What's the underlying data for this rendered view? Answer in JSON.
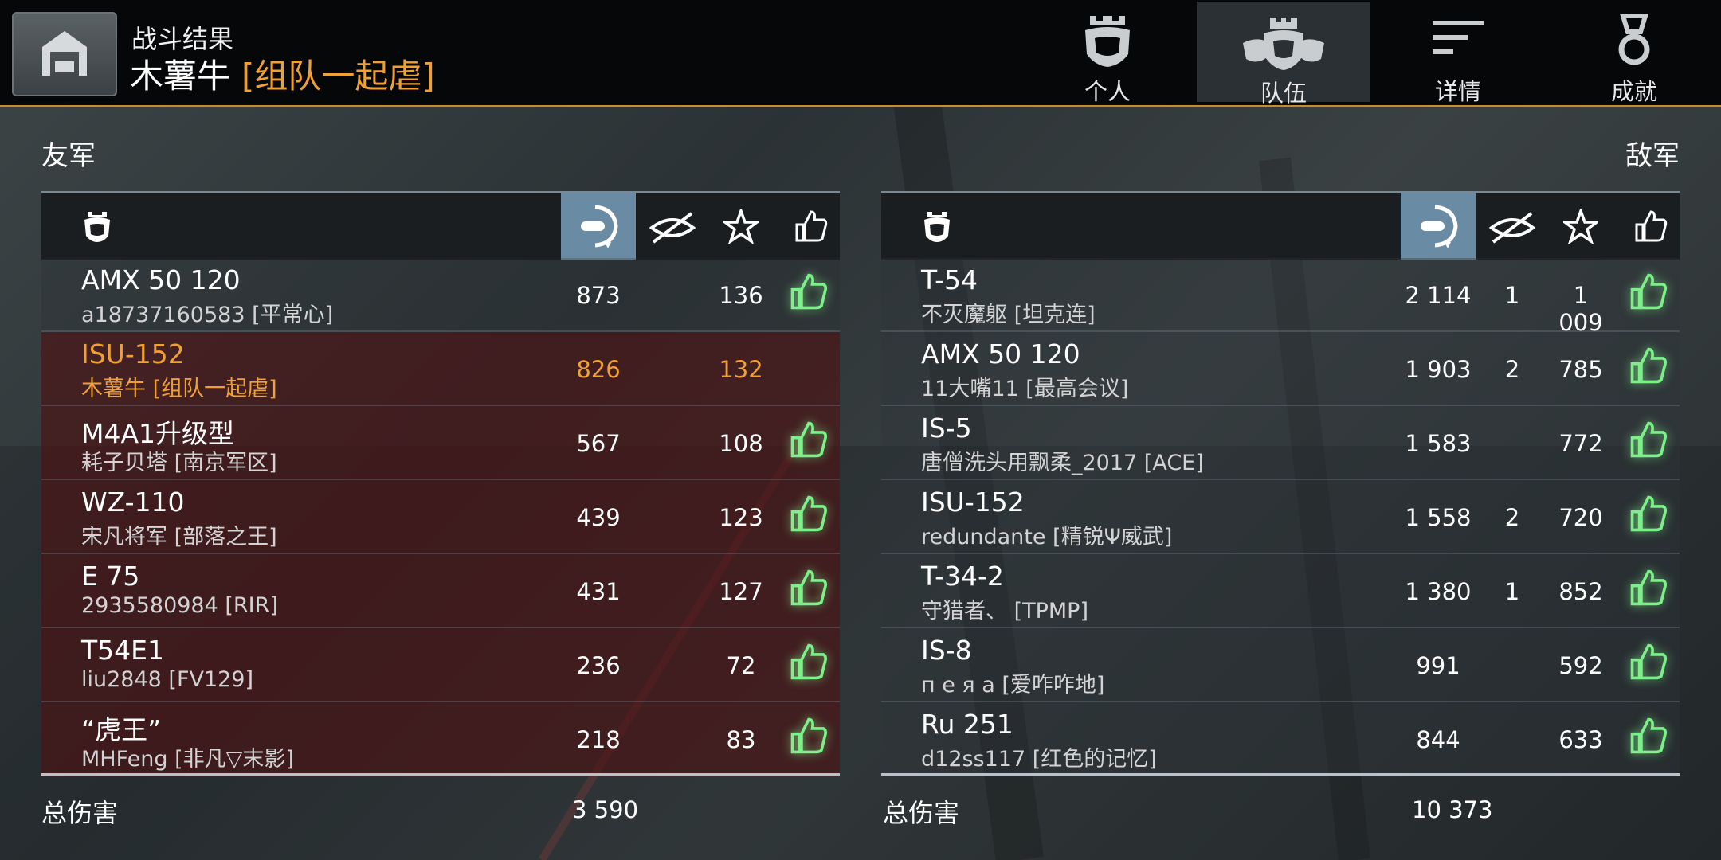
{
  "header": {
    "subtitle": "战斗结果",
    "player_name": "木薯牛",
    "player_clan": "[组队一起虐]"
  },
  "tabs": [
    {
      "label": "个人",
      "icon": "helmet-icon",
      "active": false
    },
    {
      "label": "队伍",
      "icon": "team-helmets-icon",
      "active": true
    },
    {
      "label": "详情",
      "icon": "list-lines-icon",
      "active": false
    },
    {
      "label": "成就",
      "icon": "medal-icon",
      "active": false
    }
  ],
  "allies": {
    "label": "友军",
    "rows": [
      {
        "vehicle": "AMX 50 120",
        "player": "a18737160583 [平常心]",
        "damage": "873",
        "spotted": "",
        "exp": "136",
        "liked": true
      },
      {
        "vehicle": "ISU-152",
        "player": "木薯牛 [组队一起虐]",
        "damage": "826",
        "spotted": "",
        "exp": "132",
        "liked": false
      },
      {
        "vehicle": "M4A1升级型",
        "player": "耗子贝塔 [南京军区]",
        "damage": "567",
        "spotted": "",
        "exp": "108",
        "liked": true
      },
      {
        "vehicle": "WZ-110",
        "player": "宋凡将军 [部落之王]",
        "damage": "439",
        "spotted": "",
        "exp": "123",
        "liked": true
      },
      {
        "vehicle": "E 75",
        "player": "2935580984 [RIR]",
        "damage": "431",
        "spotted": "",
        "exp": "127",
        "liked": true
      },
      {
        "vehicle": "T54E1",
        "player": "liu2848 [FV129]",
        "damage": "236",
        "spotted": "",
        "exp": "72",
        "liked": true
      },
      {
        "vehicle": "“虎王”",
        "player": "MHFeng [非凡▽末影]",
        "damage": "218",
        "spotted": "",
        "exp": "83",
        "liked": true
      }
    ],
    "total_label": "总伤害",
    "total_damage": "3 590"
  },
  "enemies": {
    "label": "敌军",
    "rows": [
      {
        "vehicle": "T-54",
        "player": "不灭魔躯 [坦克连]",
        "damage": "2 114",
        "spotted": "1",
        "exp": "1 009",
        "liked": true
      },
      {
        "vehicle": "AMX 50 120",
        "player": "11大嘴11 [最高会议]",
        "damage": "1 903",
        "spotted": "2",
        "exp": "785",
        "liked": true
      },
      {
        "vehicle": "IS-5",
        "player": "唐僧洗头用飘柔_2017 [ACE]",
        "damage": "1 583",
        "spotted": "",
        "exp": "772",
        "liked": true
      },
      {
        "vehicle": "ISU-152",
        "player": "redundante [精锐Ψ威武]",
        "damage": "1 558",
        "spotted": "2",
        "exp": "720",
        "liked": true
      },
      {
        "vehicle": "T-34-2",
        "player": "守猎者、 [TPMP]",
        "damage": "1 380",
        "spotted": "1",
        "exp": "852",
        "liked": true
      },
      {
        "vehicle": "IS-8",
        "player": "п е я а [爱咋咋地]",
        "damage": "991",
        "spotted": "",
        "exp": "592",
        "liked": true
      },
      {
        "vehicle": "Ru 251",
        "player": "d12ss117 [红色的记忆]",
        "damage": "844",
        "spotted": "",
        "exp": "633",
        "liked": true
      }
    ],
    "total_label": "总伤害",
    "total_damage": "10 373"
  },
  "colors": {
    "accent": "#f0a135",
    "ally_row": "#4e1012",
    "sorted_col": "#6a8ba4",
    "like": "#7ef08a"
  }
}
